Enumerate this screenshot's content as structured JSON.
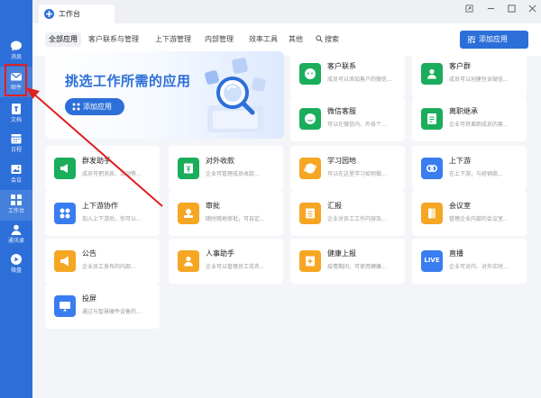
{
  "window": {
    "tab_title": "工作台"
  },
  "sidebar": {
    "items": [
      {
        "label": "消息",
        "icon": "message-icon"
      },
      {
        "label": "邮件",
        "icon": "mail-icon"
      },
      {
        "label": "文档",
        "icon": "document-icon"
      },
      {
        "label": "日程",
        "icon": "calendar-icon"
      },
      {
        "label": "会议",
        "icon": "meeting-icon"
      },
      {
        "label": "工作台",
        "icon": "workbench-icon"
      },
      {
        "label": "通讯录",
        "icon": "contacts-icon"
      },
      {
        "label": "微盘",
        "icon": "drive-icon"
      }
    ],
    "highlight_color": "#e02020"
  },
  "nav": {
    "tabs": [
      "全部应用",
      "客户联系与管理",
      "上下游管理",
      "内部管理",
      "效率工具",
      "其他"
    ],
    "search_label": "搜索",
    "add_button": "添加应用"
  },
  "hero": {
    "title": "挑选工作所需的应用",
    "button": "添加应用"
  },
  "apps": [
    {
      "name": "客户联系",
      "desc": "成员可以添加客户的微信...",
      "color": "#1aad5c",
      "icon": "customer-contact-icon"
    },
    {
      "name": "客户群",
      "desc": "成员可以创建包含微信...",
      "color": "#1aad5c",
      "icon": "customer-group-icon"
    },
    {
      "name": "微信客服",
      "desc": "可以在微信内、外各个...",
      "color": "#1aad5c",
      "icon": "wechat-service-icon"
    },
    {
      "name": "离职继承",
      "desc": "企业可将离职成员的客...",
      "color": "#1aad5c",
      "icon": "resignation-inherit-icon"
    },
    {
      "name": "群发助手",
      "desc": "成员可把消息、活动等...",
      "color": "#1aad5c",
      "icon": "broadcast-icon"
    },
    {
      "name": "对外收款",
      "desc": "企业可管理成员收款...",
      "color": "#1aad5c",
      "icon": "payment-icon"
    },
    {
      "name": "学习园地",
      "desc": "可以在这里学习如何做...",
      "color": "#f5a623",
      "icon": "learning-icon"
    },
    {
      "name": "上下游",
      "desc": "在上下游，与经销商...",
      "color": "#3a7df0",
      "icon": "upstream-downstream-icon"
    },
    {
      "name": "上下游协作",
      "desc": "加入上下游后，你可以...",
      "color": "#3a7df0",
      "icon": "collaboration-icon"
    },
    {
      "name": "审批",
      "desc": "随时随地审批，可自定...",
      "color": "#f5a623",
      "icon": "approval-icon"
    },
    {
      "name": "汇报",
      "desc": "企业对员工工作内容及...",
      "color": "#f5a623",
      "icon": "report-icon"
    },
    {
      "name": "会议室",
      "desc": "管理企业内部的会议室...",
      "color": "#f5a623",
      "icon": "meeting-room-icon"
    },
    {
      "name": "公告",
      "desc": "企业员工发布的内部...",
      "color": "#f5a623",
      "icon": "announcement-icon"
    },
    {
      "name": "人事助手",
      "desc": "企业可以管理员工花名...",
      "color": "#f5a623",
      "icon": "hr-assistant-icon"
    },
    {
      "name": "健康上报",
      "desc": "疫情期间，可使用健康...",
      "color": "#f5a623",
      "icon": "health-report-icon"
    },
    {
      "name": "直播",
      "desc": "企业可对内、对外实时...",
      "color": "#3a7df0",
      "icon": "live-icon",
      "badge": "LIVE"
    },
    {
      "name": "投屏",
      "desc": "通过与智慧硬件设备的...",
      "color": "#3a7df0",
      "icon": "screen-cast-icon"
    }
  ]
}
